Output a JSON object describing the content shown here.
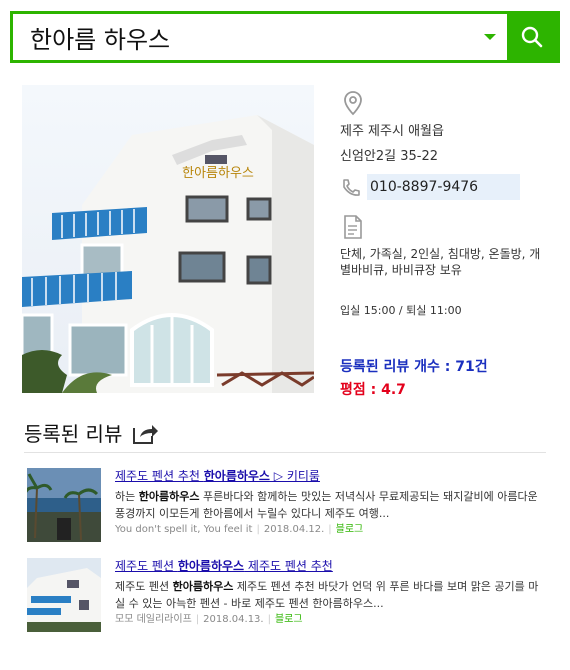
{
  "search": {
    "value": "한아름 하우스"
  },
  "place": {
    "address_line1": "제주 제주시 애월읍",
    "address_line2": "신엄안2길 35-22",
    "phone": "010-8897-9476",
    "amenities": "단체, 가족실, 2인실, 침대방, 온돌방, 개별바비큐, 바비큐장 보유",
    "checkin": "입실 15:00 / 퇴실 11:00",
    "review_count": "등록된 리뷰 개수 : 71건",
    "rating": "평점 : 4.7",
    "photo_sign": "한아름하우스"
  },
  "reviews_section": {
    "title": "등록된 리뷰"
  },
  "reviews": [
    {
      "title_pre": "제주도 펜션 추천 ",
      "title_bold": "한아름하우스",
      "title_post": " ▷ 키티룸",
      "desc_pre": "하는 ",
      "desc_bold": "한아름하우스",
      "desc_post": " 푸른바다와 함께하는 맛있는 저녁식사 무료제공되는 돼지갈비에 아름다운 풍경까지 이모든게 한아름에서 누릴수 있다니 제주도 여행...",
      "author": "You don't spell it, You feel it",
      "date": "2018.04.12.",
      "source": "블로그"
    },
    {
      "title_pre": "제주도 펜션 ",
      "title_bold": "한아름하우스",
      "title_post": " 제주도 펜션 추천",
      "desc_pre": "제주도 펜션 ",
      "desc_bold": "한아름하우스",
      "desc_post": " 제주도 펜션 추천 바닷가 언덕 위 푸른 바다를 보며 맑은 공기를 마실 수 있는 아늑한 펜션 - 바로 제주도 펜션 한아름하우스...",
      "author": "모모 데일리라이프",
      "date": "2018.04.13.",
      "source": "블로그"
    }
  ],
  "colors": {
    "brand": "#2db400",
    "count": "#1a2fbf",
    "rating": "#e3001b"
  }
}
